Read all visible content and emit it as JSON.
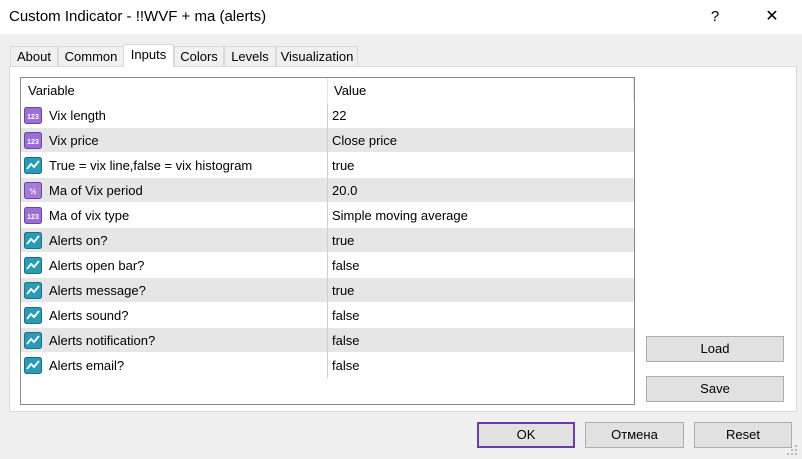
{
  "window": {
    "title": "Custom Indicator - !!WVF + ma (alerts)",
    "help_glyph": "?",
    "close_glyph": "✕"
  },
  "tabs": [
    {
      "label": "About"
    },
    {
      "label": "Common"
    },
    {
      "label": "Inputs",
      "active": true
    },
    {
      "label": "Colors"
    },
    {
      "label": "Levels"
    },
    {
      "label": "Visualization"
    }
  ],
  "grid": {
    "headers": {
      "variable": "Variable",
      "value": "Value"
    },
    "rows": [
      {
        "icon": "integer-icon",
        "variable": "Vix length",
        "value": "22"
      },
      {
        "icon": "integer-icon",
        "variable": "Vix price",
        "value": "Close price"
      },
      {
        "icon": "boolean-icon",
        "variable": "True = vix line,false = vix histogram",
        "value": "true"
      },
      {
        "icon": "double-icon",
        "variable": "Ma of Vix period",
        "value": "20.0"
      },
      {
        "icon": "integer-icon",
        "variable": "Ma of vix type",
        "value": "Simple moving average"
      },
      {
        "icon": "boolean-icon",
        "variable": "Alerts on?",
        "value": "true"
      },
      {
        "icon": "boolean-icon",
        "variable": "Alerts open bar?",
        "value": "false"
      },
      {
        "icon": "boolean-icon",
        "variable": "Alerts message?",
        "value": "true"
      },
      {
        "icon": "boolean-icon",
        "variable": "Alerts sound?",
        "value": "false"
      },
      {
        "icon": "boolean-icon",
        "variable": "Alerts notification?",
        "value": "false"
      },
      {
        "icon": "boolean-icon",
        "variable": "Alerts email?",
        "value": "false"
      }
    ]
  },
  "side_buttons": {
    "load": "Load",
    "save": "Save"
  },
  "footer_buttons": {
    "ok": "OK",
    "cancel": "Отмена",
    "reset": "Reset"
  },
  "colors": {
    "default_button_border": "#6b3fa0",
    "integer_icon": "#9b6fd6",
    "boolean_icon": "#2a9bb5",
    "double_icon": "#a97bd9"
  }
}
